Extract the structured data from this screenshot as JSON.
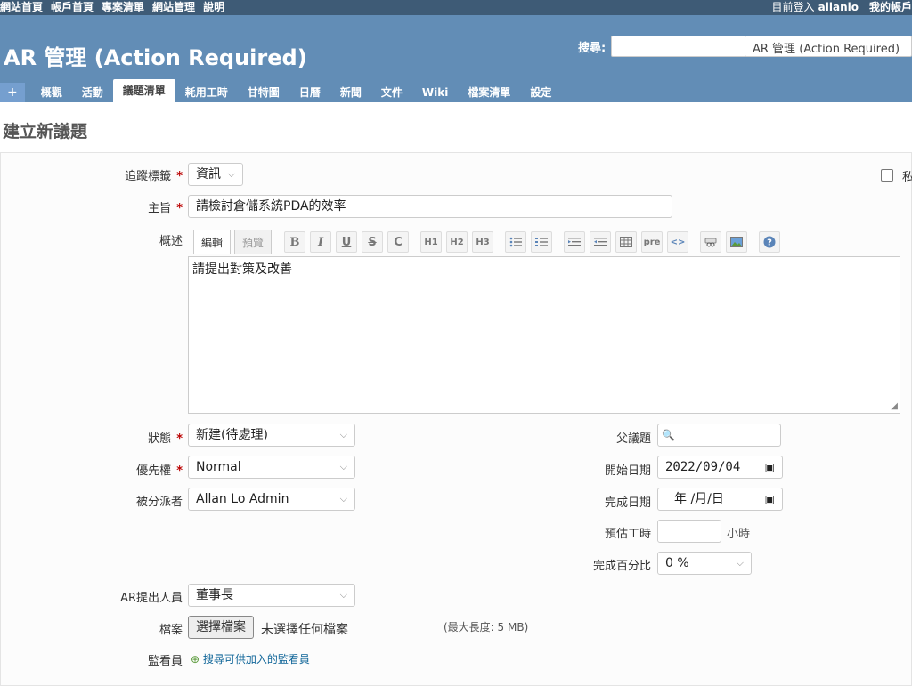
{
  "top_menu": {
    "left": [
      "網站首頁",
      "帳戶首頁",
      "專案清單",
      "網站管理",
      "說明"
    ],
    "logged_as_label": "目前登入",
    "user": "allanlo",
    "my_account": "我的帳戶"
  },
  "header": {
    "title": "AR 管理 (Action Required)",
    "search_label": "搜尋:",
    "search_value": "",
    "project_jump": "AR 管理 (Action Required)"
  },
  "tabs": {
    "plus": "+",
    "items": [
      "概觀",
      "活動",
      "議題清單",
      "耗用工時",
      "甘特圖",
      "日曆",
      "新聞",
      "文件",
      "Wiki",
      "檔案清單",
      "設定"
    ],
    "selected": "議題清單"
  },
  "page": {
    "heading": "建立新議題"
  },
  "form": {
    "tracker_label": "追蹤標籤",
    "tracker_value": "資訊",
    "private_label": "私",
    "subject_label": "主旨",
    "subject_value": "請檢討倉儲系統PDA的效率",
    "description_label": "概述",
    "editor_tab_edit": "編輯",
    "editor_tab_preview": "預覽",
    "toolbar_labels": [
      "B",
      "I",
      "U",
      "S",
      "C",
      "H1",
      "H2",
      "H3",
      "pre",
      "<>",
      "?"
    ],
    "description_value": "請提出對策及改善",
    "status_label": "狀態",
    "status_value": "新建(待處理)",
    "priority_label": "優先權",
    "priority_value": "Normal",
    "assignee_label": "被分派者",
    "assignee_value": "Allan Lo Admin",
    "parent_label": "父議題",
    "parent_value": "",
    "start_date_label": "開始日期",
    "start_date_value": "2022/09/04",
    "due_date_label": "完成日期",
    "due_date_value": "年 /月/日",
    "estimated_label": "預估工時",
    "estimated_value": "",
    "hours_unit": "小時",
    "done_ratio_label": "完成百分比",
    "done_ratio_value": "0 %",
    "ar_raiser_label": "AR提出人員",
    "ar_raiser_value": "董事長",
    "files_label": "檔案",
    "choose_file": "選擇檔案",
    "no_file": "未選擇任何檔案",
    "max_size": "(最大長度: 5 MB)",
    "watchers_label": "監看員",
    "watchers_link": "搜尋可供加入的監看員"
  }
}
